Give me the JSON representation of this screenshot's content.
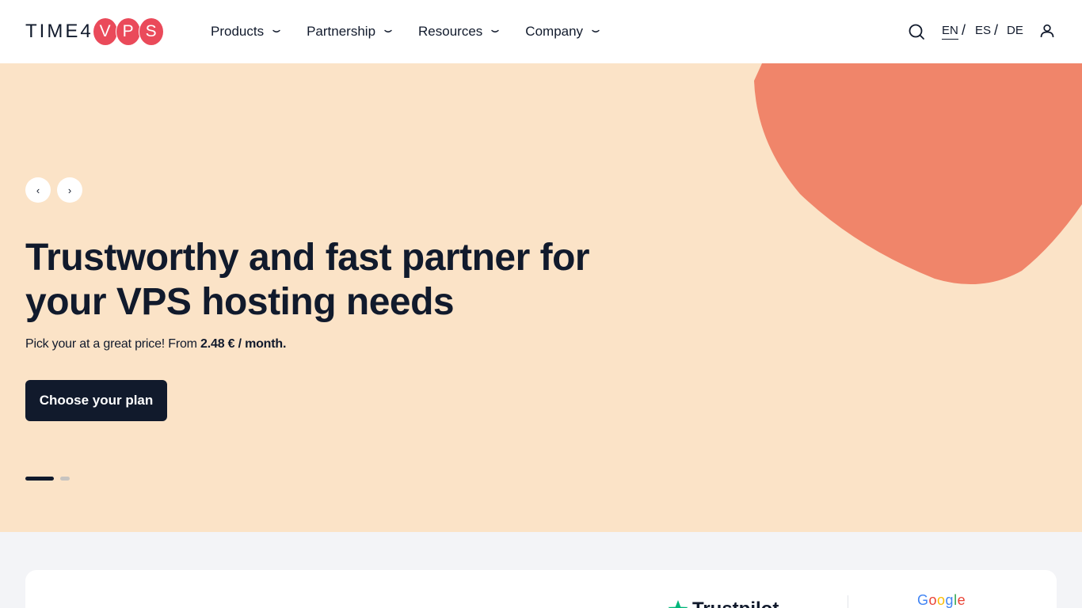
{
  "brand": {
    "wordmark": "TIME4",
    "bubbles": [
      "V",
      "P",
      "S"
    ],
    "bubble_color": "#ea4a5a"
  },
  "nav": {
    "items": [
      {
        "label": "Products"
      },
      {
        "label": "Partnership"
      },
      {
        "label": "Resources"
      },
      {
        "label": "Company"
      }
    ]
  },
  "tools": {
    "search_icon": "search-icon",
    "languages": [
      {
        "code": "EN",
        "active": true
      },
      {
        "code": "ES",
        "active": false
      },
      {
        "code": "DE",
        "active": false
      }
    ],
    "separator": "/",
    "user_icon": "user-icon"
  },
  "hero": {
    "background": "#fbe3c7",
    "blob_color": "#f0856a",
    "prev_arrow": "‹",
    "next_arrow": "›",
    "title": "Trustworthy and fast partner for your VPS hosting needs",
    "subtitle_prefix": "Pick your at a great price! From ",
    "subtitle_price": "2.48 € / month.",
    "cta_label": "Choose your plan",
    "slides": {
      "current": 1,
      "total": 2
    }
  },
  "reviews": {
    "trustpilot_label": "Trustpilot",
    "google_letters": [
      "G",
      "o",
      "o",
      "g",
      "l",
      "e"
    ]
  }
}
